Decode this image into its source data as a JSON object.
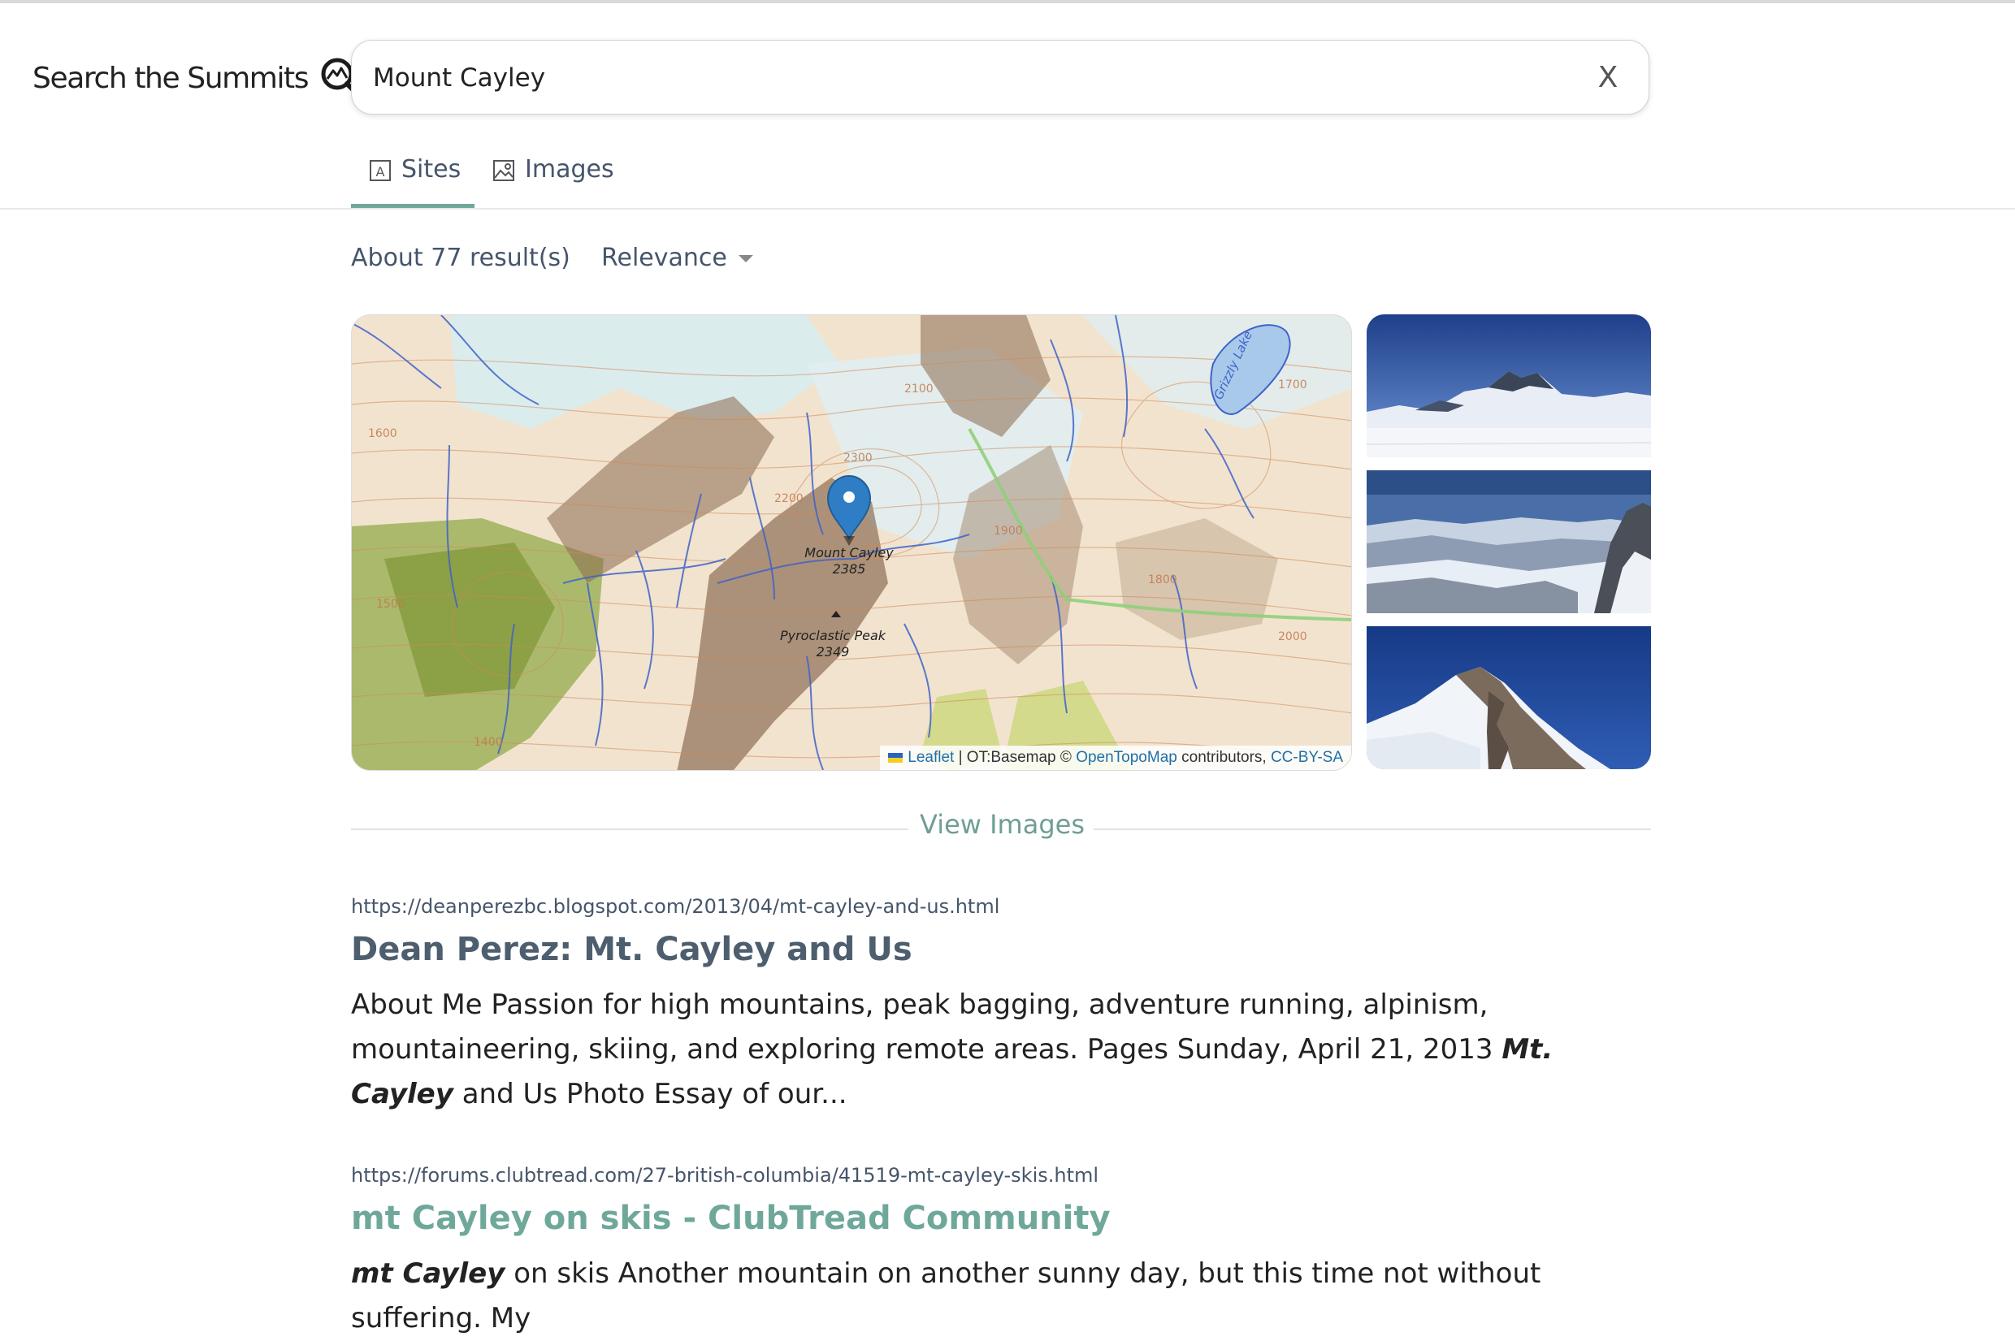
{
  "brand": {
    "title": "Search the Summits"
  },
  "search": {
    "query": "Mount Cayley",
    "clear_label": "X"
  },
  "tabs": [
    {
      "label": "Sites",
      "active": true
    },
    {
      "label": "Images",
      "active": false
    }
  ],
  "results_meta": {
    "count_text": "About 77 result(s)",
    "sort_value": "Relevance"
  },
  "map": {
    "peak_name": "Mount Cayley",
    "peak_elevation": "2385",
    "secondary_peak_name": "Pyroclastic Peak",
    "secondary_peak_elevation": "2349",
    "lake_name": "Grizzly Lake",
    "contour_labels": [
      "2100",
      "1900",
      "1800",
      "1600",
      "1700",
      "2000",
      "1500",
      "1400",
      "2200",
      "2300"
    ],
    "attribution": {
      "leaflet": "Leaflet",
      "separator": " | OT:Basemap © ",
      "opentopomap": "OpenTopoMap",
      "contributors": " contributors, ",
      "license": "CC-BY-SA"
    }
  },
  "view_images_label": "View Images",
  "results": [
    {
      "url": "https://deanperezbc.blogspot.com/2013/04/mt-cayley-and-us.html",
      "title": "Dean Perez: Mt. Cayley and Us",
      "snippet_parts": [
        "About Me Passion for high mountains, peak bagging, adventure running, alpinism, mountaineering, skiing, and exploring remote areas. Pages Sunday, April 21, 2013 ",
        "Mt. Cayley",
        " and Us Photo Essay of our..."
      ]
    },
    {
      "url": "https://forums.clubtread.com/27-british-columbia/41519-mt-cayley-skis.html",
      "title": "mt Cayley on skis - ClubTread Community",
      "snippet_parts": [
        "mt Cayley",
        " on skis Another mountain on another sunny day, but this time not without suffering. My"
      ]
    }
  ],
  "colors": {
    "accent": "#6fa89b",
    "text": "#46556a",
    "title_visited": "#4d5e6e"
  }
}
